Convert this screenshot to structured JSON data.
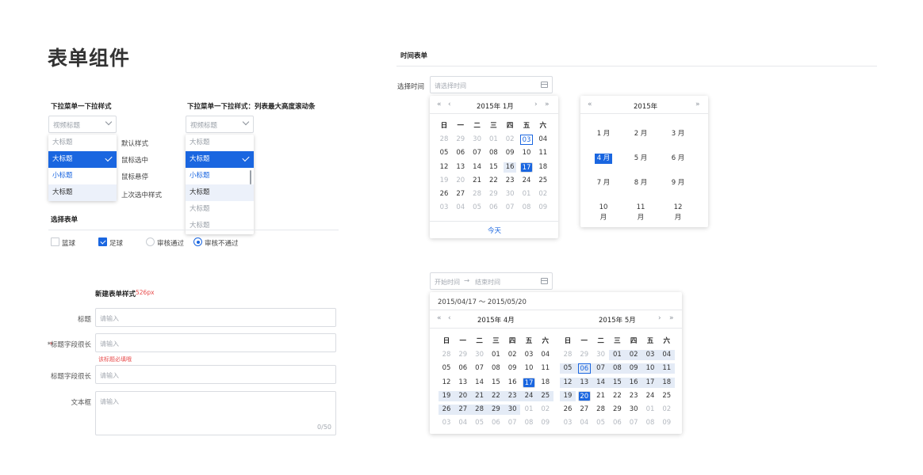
{
  "page_title": "表单组件",
  "dropdown1": {
    "heading": "下拉菜单一下拉样式",
    "placeholder": "视频标题",
    "items": [
      "大标题",
      "大标题",
      "小标题",
      "大标题"
    ],
    "notes": [
      "默认样式",
      "鼠标选中",
      "鼠标悬停",
      "上次选中样式"
    ]
  },
  "dropdown2": {
    "heading": "下拉菜单一下拉样式：列表最大高度滚动条",
    "placeholder": "视频标题",
    "items": [
      "大标题",
      "大标题",
      "小标题",
      "大标题",
      "大标题",
      "大标题"
    ]
  },
  "choice": {
    "heading": "选择表单",
    "checkbox1": "篮球",
    "checkbox2": "足球",
    "radio1": "审核通过",
    "radio2": "审核不通过"
  },
  "newform": {
    "heading": "新建表单样式",
    "width_note": "526px",
    "fields": [
      {
        "label": "标题",
        "placeholder": "请输入"
      },
      {
        "label": "*标题字段很长",
        "placeholder": "请输入",
        "error": "该标题必填哦"
      },
      {
        "label": "标题字段很长",
        "placeholder": "请输入"
      },
      {
        "label": "文本框",
        "placeholder": "请输入",
        "counter": "0/50"
      }
    ]
  },
  "time": {
    "heading": "时间表单",
    "label": "选择时间",
    "placeholder": "请选择时间",
    "cal1": {
      "header": "2015年 1月",
      "weekdays": [
        "日",
        "一",
        "二",
        "三",
        "四",
        "五",
        "六"
      ],
      "rows": [
        [
          "28",
          "29",
          "30",
          "01",
          "02",
          "03",
          "04"
        ],
        [
          "05",
          "06",
          "07",
          "08",
          "09",
          "10",
          "11"
        ],
        [
          "12",
          "13",
          "14",
          "15",
          "16",
          "17",
          "18"
        ],
        [
          "19",
          "20",
          "21",
          "22",
          "23",
          "24",
          "25"
        ],
        [
          "26",
          "27",
          "28",
          "29",
          "30",
          "01",
          "02"
        ],
        [
          "03",
          "04",
          "05",
          "06",
          "07",
          "08",
          "09"
        ]
      ],
      "today_label": "今天"
    },
    "months": {
      "header": "2015年",
      "items": [
        "1 月",
        "2 月",
        "3 月",
        "4 月",
        "5 月",
        "6 月",
        "7 月",
        "8 月",
        "9 月",
        "10 月",
        "11 月",
        "12 月"
      ]
    },
    "range": {
      "start_placeholder": "开始时间",
      "arrow": "→",
      "end_placeholder": "结束时间",
      "selected": "2015/04/17 ～ 2015/05/20",
      "left_header": "2015年 4月",
      "right_header": "2015年 5月",
      "left_rows": [
        [
          "28",
          "29",
          "30",
          "01",
          "02",
          "03",
          "04"
        ],
        [
          "05",
          "06",
          "07",
          "08",
          "09",
          "10",
          "11"
        ],
        [
          "12",
          "13",
          "14",
          "15",
          "16",
          "17",
          "18"
        ],
        [
          "19",
          "20",
          "21",
          "22",
          "23",
          "24",
          "25"
        ],
        [
          "26",
          "27",
          "28",
          "29",
          "30",
          "01",
          "02"
        ],
        [
          "03",
          "04",
          "05",
          "06",
          "07",
          "08",
          "09"
        ]
      ],
      "right_rows": [
        [
          "28",
          "29",
          "30",
          "01",
          "02",
          "03",
          "04"
        ],
        [
          "05",
          "06",
          "07",
          "08",
          "09",
          "10",
          "11"
        ],
        [
          "12",
          "13",
          "14",
          "15",
          "16",
          "17",
          "18"
        ],
        [
          "19",
          "20",
          "21",
          "22",
          "23",
          "24",
          "25"
        ],
        [
          "26",
          "27",
          "28",
          "29",
          "30",
          "01",
          "02"
        ],
        [
          "03",
          "04",
          "05",
          "06",
          "07",
          "08",
          "09"
        ]
      ]
    }
  },
  "colors": {
    "primary": "#1a66e0",
    "error": "#e84b4b",
    "range_bg": "#e4ebf6"
  }
}
